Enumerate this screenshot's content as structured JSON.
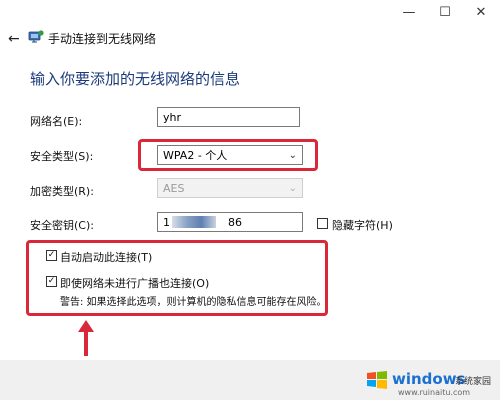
{
  "window": {
    "title": "手动连接到无线网络",
    "controls": {
      "minimize": "—",
      "maximize": "☐",
      "close": "✕"
    },
    "back": "←"
  },
  "header": "输入你要添加的无线网络的信息",
  "form": {
    "network_name": {
      "label": "网络名(E):",
      "value": "yhr"
    },
    "security_type": {
      "label": "安全类型(S):",
      "value": "WPA2 - 个人"
    },
    "encryption_type": {
      "label": "加密类型(R):",
      "value": "AES"
    },
    "security_key": {
      "label": "安全密钥(C):",
      "value_prefix": "1",
      "value_suffix": "86"
    },
    "hide_chars": {
      "label": "隐藏字符(H)",
      "checked": false
    }
  },
  "options": {
    "auto_connect": {
      "label": "自动启动此连接(T)",
      "checked": true
    },
    "connect_hidden": {
      "label": "即使网络未进行广播也连接(O)",
      "checked": true
    },
    "warning": "警告: 如果选择此选项，则计算机的隐私信息可能存在风险。"
  },
  "watermark": {
    "brand": "windows",
    "suffix": "系统家园",
    "url": "www.ruinaitu.com"
  },
  "colors": {
    "highlight": "#d8283a",
    "header_text": "#1a3a7a",
    "logo_blue": "#1a6fd0"
  }
}
